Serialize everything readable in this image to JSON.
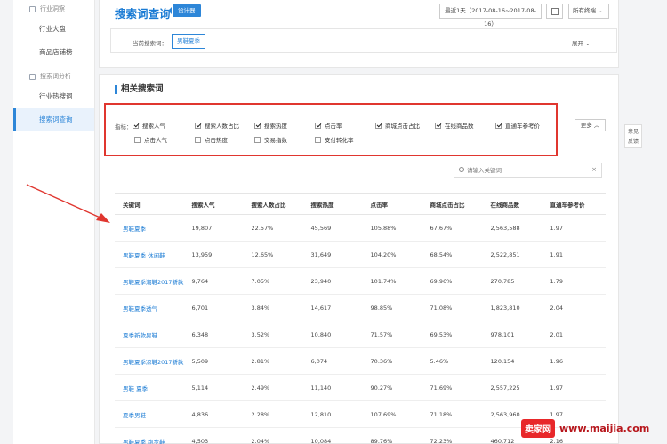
{
  "sidebar": {
    "groups": [
      {
        "label": "行业洞察",
        "items": [
          "行业大盘",
          "商品店铺榜"
        ]
      },
      {
        "label": "搜索词分析",
        "items": [
          "行业热搜词",
          "搜索词查询"
        ]
      }
    ],
    "active_item": "搜索词查询"
  },
  "header": {
    "title": "搜索词查询",
    "badge": "设计器",
    "date_range": "最近1天（2017-08-16~2017-08-16）",
    "terminal": "所有终端",
    "current_label": "当前搜索词：",
    "current_term": "男鞋夏季",
    "expand_label": "展开"
  },
  "section_title": "相关搜索词",
  "indicators": {
    "label": "指标：",
    "items": [
      {
        "label": "搜索人气",
        "checked": true
      },
      {
        "label": "搜索人数占比",
        "checked": true
      },
      {
        "label": "搜索热度",
        "checked": true
      },
      {
        "label": "点击率",
        "checked": true
      },
      {
        "label": "商城点击占比",
        "checked": true
      },
      {
        "label": "在线商品数",
        "checked": true
      },
      {
        "label": "直通车参考价",
        "checked": true
      },
      {
        "label": "点击人气",
        "checked": false
      },
      {
        "label": "点击热度",
        "checked": false
      },
      {
        "label": "交易指数",
        "checked": false
      },
      {
        "label": "支付转化率",
        "checked": false
      }
    ],
    "more_label": "更多"
  },
  "search": {
    "placeholder": "请输入关键词"
  },
  "table": {
    "headers": [
      "关键词",
      "搜索人气",
      "搜索人数占比",
      "搜索热度",
      "点击率",
      "商城点击占比",
      "在线商品数",
      "直通车参考价"
    ],
    "rows": [
      [
        "男鞋夏季",
        "19,807",
        "22.57%",
        "45,569",
        "105.88%",
        "67.67%",
        "2,563,588",
        "1.97"
      ],
      [
        "男鞋夏季 休闲鞋",
        "13,959",
        "12.65%",
        "31,649",
        "104.20%",
        "68.54%",
        "2,522,851",
        "1.91"
      ],
      [
        "男鞋夏季潮鞋2017新款",
        "9,764",
        "7.05%",
        "23,940",
        "101.74%",
        "69.96%",
        "270,785",
        "1.79"
      ],
      [
        "男鞋夏季透气",
        "6,701",
        "3.84%",
        "14,617",
        "98.85%",
        "71.08%",
        "1,823,810",
        "2.04"
      ],
      [
        "夏季新款男鞋",
        "6,348",
        "3.52%",
        "10,840",
        "71.57%",
        "69.53%",
        "978,101",
        "2.01"
      ],
      [
        "男鞋夏季凉鞋2017新款",
        "5,509",
        "2.81%",
        "6,074",
        "70.36%",
        "5.46%",
        "120,154",
        "1.96"
      ],
      [
        "男鞋 夏季",
        "5,114",
        "2.49%",
        "11,140",
        "90.27%",
        "71.69%",
        "2,557,225",
        "1.97"
      ],
      [
        "夏季男鞋",
        "4,836",
        "2.28%",
        "12,810",
        "107.69%",
        "71.18%",
        "2,563,960",
        "1.97"
      ],
      [
        "男鞋夏季 跑步鞋",
        "4,503",
        "2.04%",
        "10,084",
        "89.76%",
        "72.23%",
        "460,712",
        "2.16"
      ]
    ]
  },
  "feedback": {
    "line1": "意见",
    "line2": "反馈"
  },
  "watermark": {
    "logo": "卖家网",
    "url": "www.maijia.com"
  },
  "colors": {
    "accent": "#2d86d8",
    "highlight_box": "#e0362f",
    "arrow": "#e0362f"
  }
}
